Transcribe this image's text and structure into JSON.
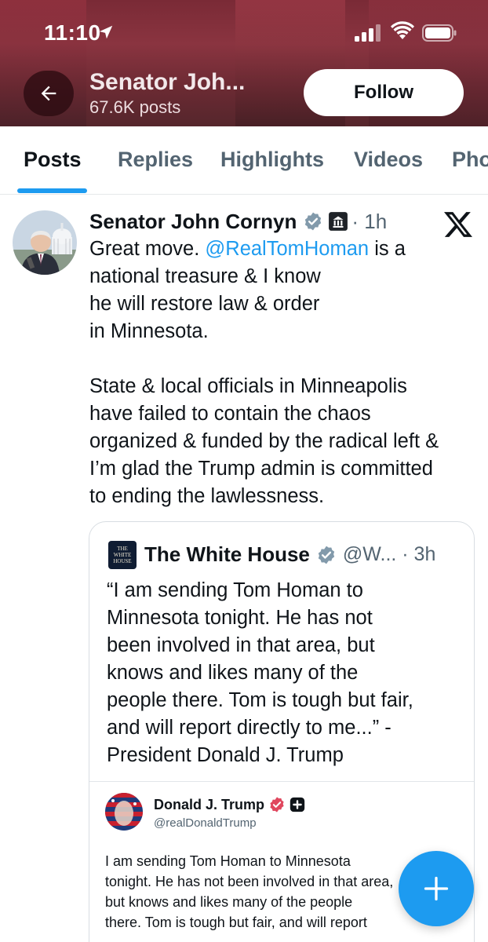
{
  "status_bar": {
    "time": "11:10",
    "icons": [
      "location-arrow-icon",
      "cellular-signal-icon",
      "wifi-icon",
      "battery-icon"
    ]
  },
  "header": {
    "profile_name": "Senator Joh...",
    "post_count": "67.6K posts",
    "follow_label": "Follow",
    "back_icon": "arrow-left-icon",
    "banner_color": "#7a2a36"
  },
  "tabs": [
    {
      "label": "Posts",
      "active": true
    },
    {
      "label": "Replies",
      "active": false
    },
    {
      "label": "Highlights",
      "active": false
    },
    {
      "label": "Videos",
      "active": false
    },
    {
      "label": "Pho",
      "active": false
    }
  ],
  "post": {
    "author": "Senator John Cornyn",
    "time": "· 1h",
    "badges": [
      "verified-gray-icon",
      "government-building-icon"
    ],
    "platform_icon": "x-logo-icon",
    "text_line1_before": "Great move. ",
    "mention": "@RealTomHoman",
    "text_line1_after": " is a",
    "text_lines": [
      "national treasure & I know",
      "he will restore law & order",
      "in Minnesota."
    ],
    "text_lines_2": [
      "State & local officials in Minneapolis",
      "have failed to contain the chaos",
      "organized & funded by the radical left &",
      "I’m glad the Trump admin is committed",
      "to ending the lawlessness."
    ]
  },
  "quote": {
    "author": "The White House",
    "handle": "@W... · 3h",
    "logo_text": "THE WHITE HOUSE",
    "text_lines": [
      "“I am sending Tom Homan to",
      "Minnesota tonight. He has not",
      "been involved in that area, but",
      "knows and likes many of the",
      "people there. Tom is tough but fair,",
      "and will report directly to me...” -",
      "President Donald J. Trump"
    ],
    "embed": {
      "author": "Donald J. Trump",
      "handle": "@realDonaldTrump",
      "text_lines": [
        "I am sending Tom Homan to Minnesota",
        "tonight. He has not been involved in that area,",
        "but knows and likes many of the people",
        "there. Tom is tough but fair, and will report"
      ]
    }
  },
  "fab": {
    "icon": "plus-icon",
    "color": "#1d9bf0"
  },
  "colors": {
    "accent": "#1d9bf0",
    "text": "#0f1419",
    "secondary_text": "#536471"
  }
}
